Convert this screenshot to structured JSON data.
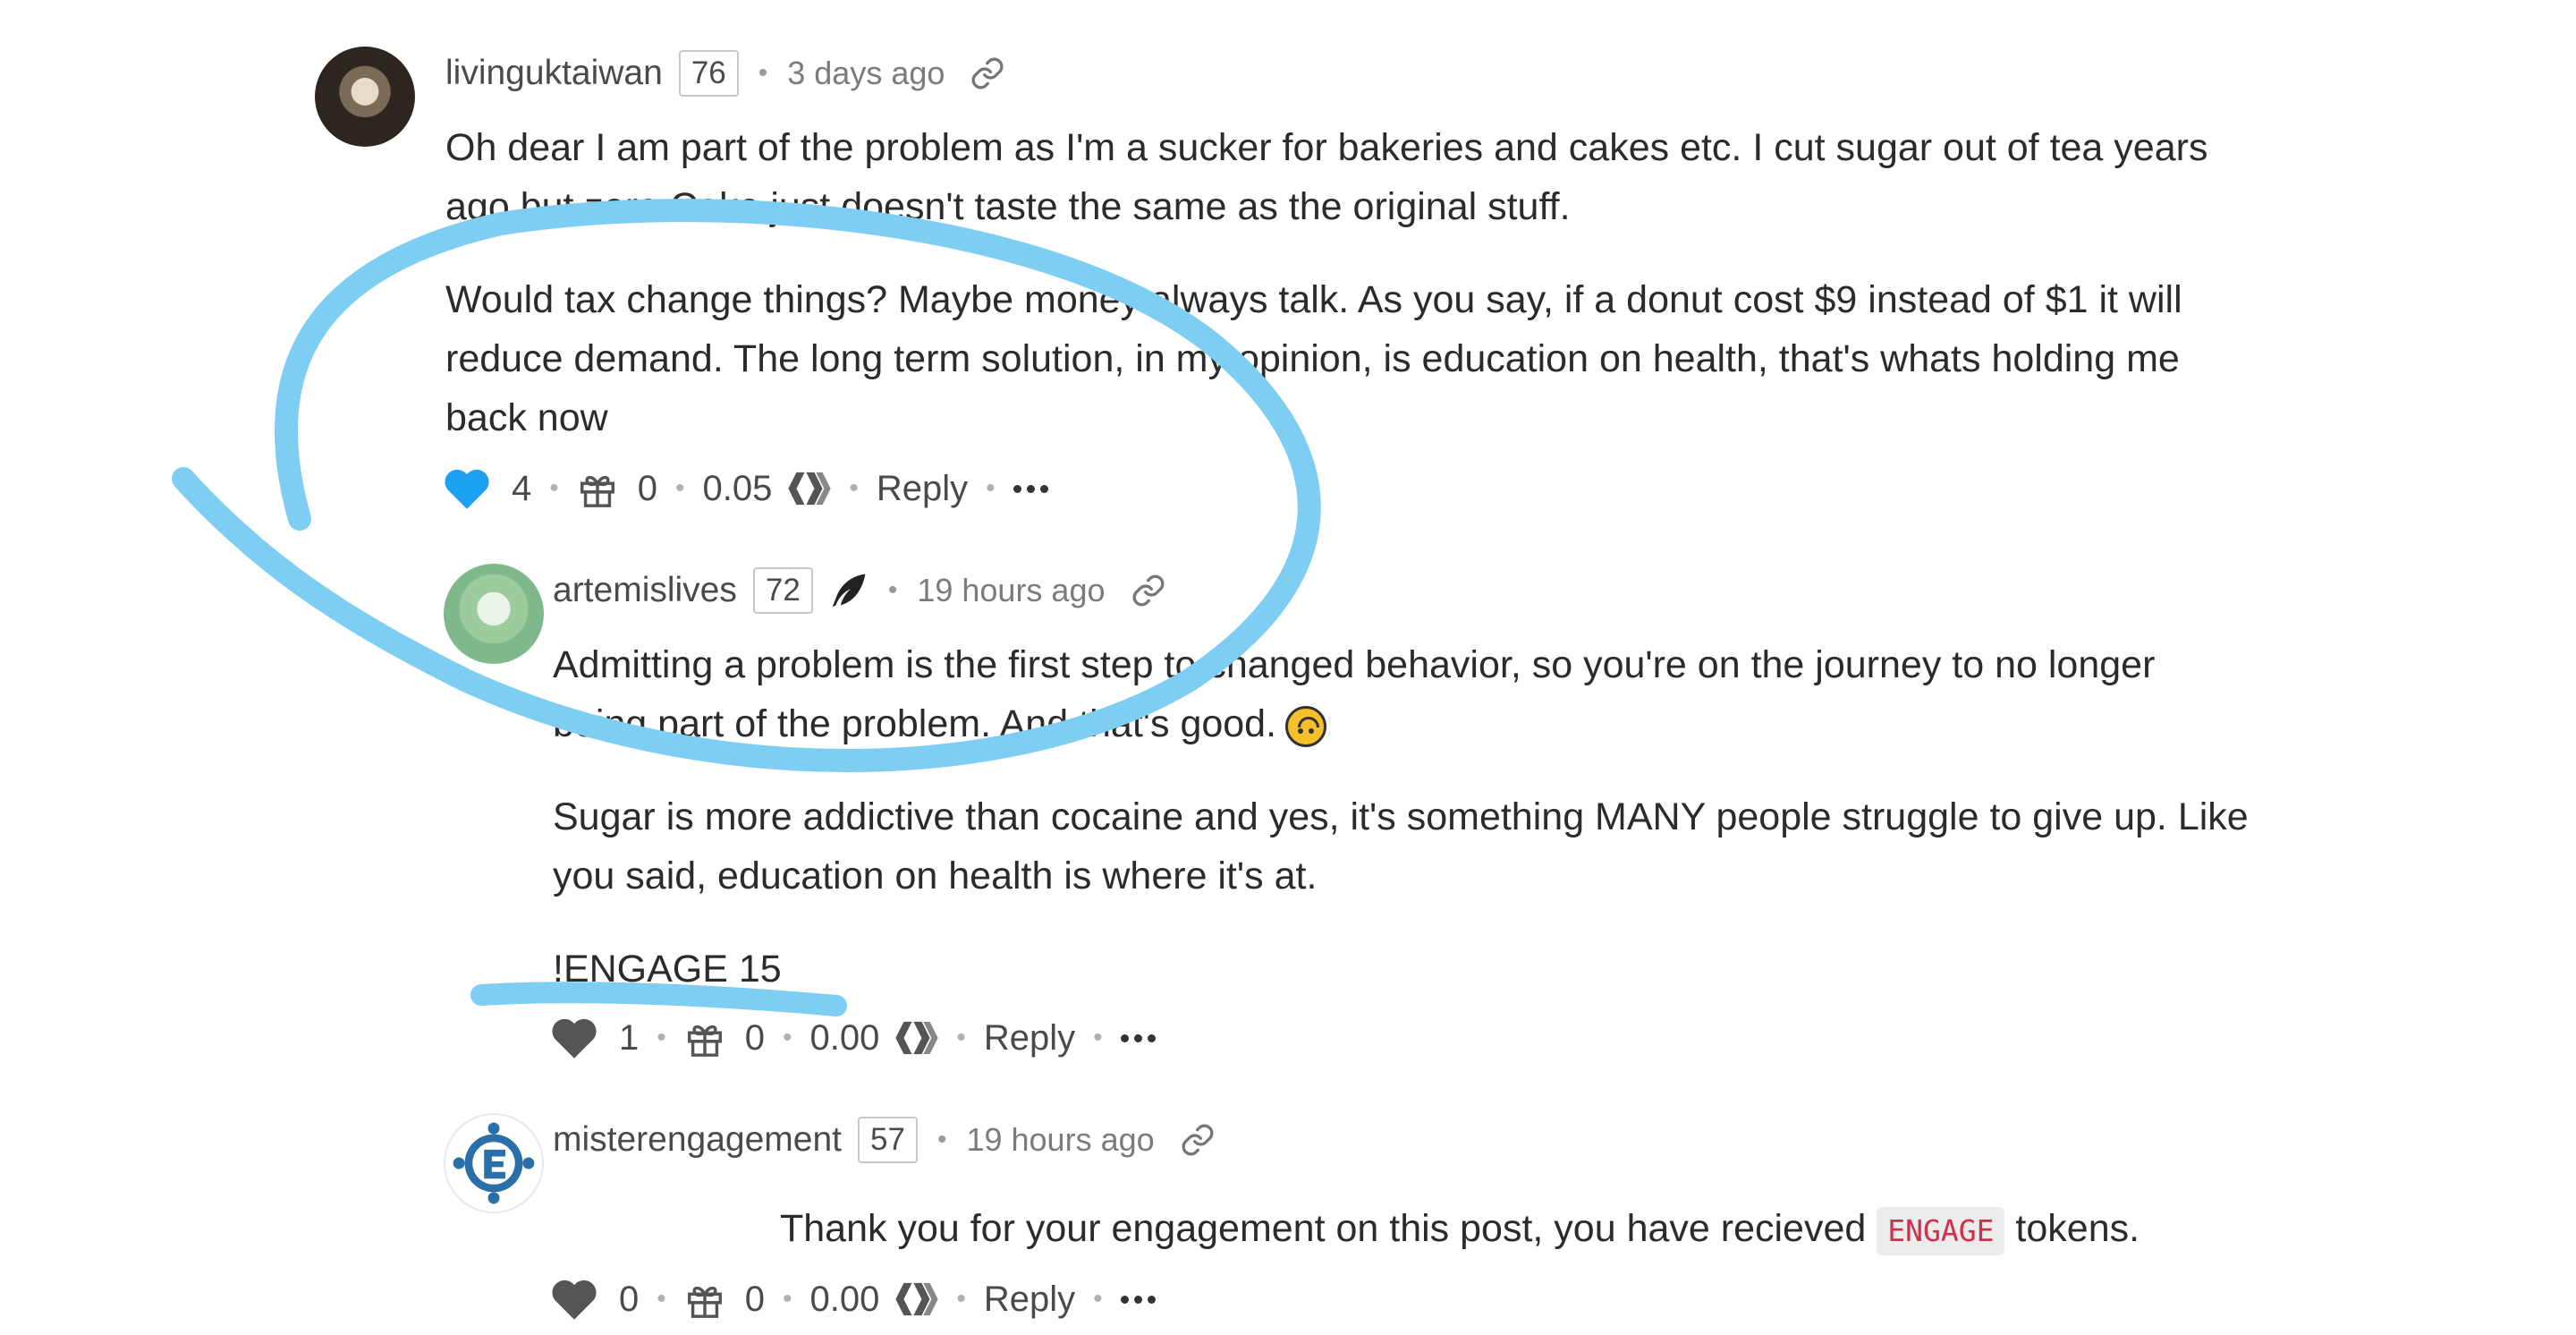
{
  "comments": [
    {
      "author": "livinguktaiwan",
      "reputation": "76",
      "time": "3 days ago",
      "paragraphs": [
        "Oh dear I am part of the problem as I'm a sucker for bakeries and cakes etc. I cut sugar out of tea years",
        "ago but zero Coke just doesn't taste the same as the original stuff.",
        "Would tax change things? Maybe money always talk. As you say, if a donut cost $9 instead of $1 it will",
        "reduce demand. The long term solution, in my opinion, is education on health, that's whats holding me",
        "back now"
      ],
      "votes": "4",
      "gifts": "0",
      "payout": "0.05",
      "reply_label": "Reply"
    },
    {
      "author": "artemislives",
      "reputation": "72",
      "time": "19 hours ago",
      "paragraphs": [
        "Admitting a problem is the first step to changed behavior, so you're on the journey to no longer",
        "being part of the problem. And that's good.",
        "Sugar is more addictive than cocaine and yes, it's something MANY people struggle to give up. Like",
        "you said, education on health is where it's at.",
        "!ENGAGE 15"
      ],
      "votes": "1",
      "gifts": "0",
      "payout": "0.00",
      "reply_label": "Reply"
    },
    {
      "author": "misterengagement",
      "reputation": "57",
      "time": "19 hours ago",
      "text_before": "Thank you for your engagement on this post, you have recieved",
      "token": "ENGAGE",
      "text_after": "tokens.",
      "votes": "0",
      "gifts": "0",
      "payout": "0.00",
      "reply_label": "Reply"
    }
  ],
  "colors": {
    "upvoted": "#1da1f2",
    "annotation": "#7ecdf2",
    "token_text": "#d0314a"
  }
}
